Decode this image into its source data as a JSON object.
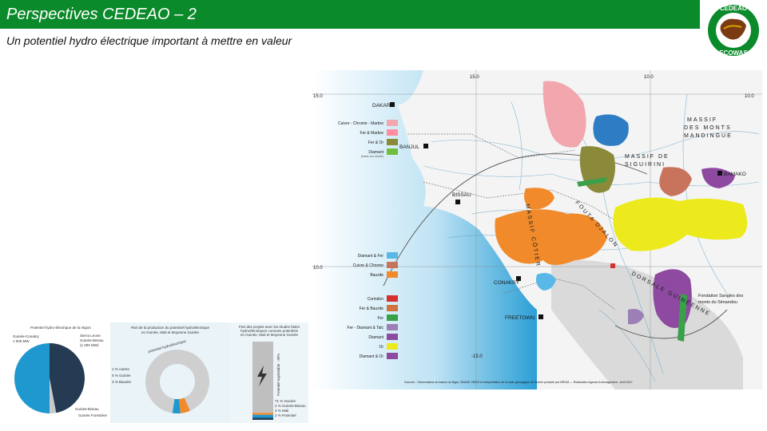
{
  "slide": {
    "title": "Perspectives CEDEAO – 2",
    "subtitle": "Un potentiel hydro électrique important à mettre en valeur"
  },
  "logo": {
    "top_text": "CEDEAO",
    "bottom_text": "ECOWAS",
    "colors": {
      "ring": "#0a8a2a",
      "inner": "#ffffff",
      "map": "#7a3b12",
      "accent": "#d9a300"
    }
  },
  "map": {
    "cities": {
      "dakar": "DAKAR",
      "banjul": "BANJUL",
      "bissau": "BISSAU",
      "conakry": "CONAKRY",
      "freetown": "FREETOWN",
      "bamako": "BAMAKO"
    },
    "regions": {
      "massif_mandingue": [
        "MASSIF",
        "DES MONTS",
        "MANDINGUE"
      ],
      "massif_siguiri": [
        "MASSIF DE",
        "SIGUIRINI"
      ],
      "fouta_djalon": "FOUTA DJALON",
      "massif_cotier": "MASSIF CÔTIER",
      "dorsale_guineenne": "DORSALE GUINÉENNE",
      "fond_guinee": [
        "Fondation Sangles des",
        "monts du Simandou"
      ]
    },
    "grid_labels": {
      "top_left": "15.0",
      "top_mid": "10.0",
      "top_right": "10.0",
      "left_top": "15.0",
      "left_mid": "10.0",
      "bottom": "-15.0"
    },
    "legend_group_1": [
      {
        "label": "Cuivre - Chrome - Marbre",
        "color": "#f2a6ae"
      },
      {
        "label": "Fer & Marbre",
        "color": "#ff8ea0"
      },
      {
        "label": "Fer & Or",
        "color": "#8a8a3a"
      },
      {
        "label": "Diamant",
        "note": "(basin non étudié)",
        "color": "#6fbf3f"
      }
    ],
    "legend_group_2": [
      {
        "label": "Diamant & Fer",
        "color": "#5ab8e8"
      },
      {
        "label": "Cuivre & Chrome",
        "color": "#c8735c"
      },
      {
        "label": "Bauxite",
        "color": "#f08a2a"
      }
    ],
    "legend_group_3": [
      {
        "label": "Corindon",
        "color": "#d4312f"
      },
      {
        "label": "Fer & Bauxite",
        "color": "#d0733c"
      },
      {
        "label": "Fer",
        "color": "#3aa04a"
      },
      {
        "label": "Fer - Diamant & Talc",
        "color": "#9b7fb5"
      },
      {
        "label": "Diamant",
        "color": "#8d4aa0"
      },
      {
        "label": "Or",
        "color": "#ecea1c"
      },
      {
        "label": "Diamant & Or",
        "color": "#8d4aa0"
      }
    ],
    "source": "Sources : Observations au bassin du Niger, SDAGE OMVS et interpretation de la carte géologique de Guinée produite par BRGM — Réalisation Agence Aménagement - Avril 2017"
  },
  "inset1": {
    "title": "Potentiel hydro-électrique de la région",
    "label_left": [
      "Guinée-Conakry",
      "1 000 MW"
    ],
    "label_right": [
      "Sierra Leone",
      "Guinée-Bissau",
      "(1 000 MW)"
    ],
    "label_bottom_1": "Guinée-Bissau",
    "label_bottom_2": "Guinée Forestière",
    "pie": [
      {
        "name": "a",
        "value": 50,
        "color": "#1f98d0"
      },
      {
        "name": "b",
        "value": 47,
        "color": "#243b53"
      },
      {
        "name": "c",
        "value": 3,
        "color": "#c9c9c9"
      }
    ]
  },
  "inset2": {
    "title": [
      "Part de la production du potentiel hydroélectrique",
      "en Guinée, Mali et Moyenne Guinée"
    ],
    "ring_label": "potentiel hydroélectrique",
    "legend": [
      "1 % Autres",
      "5 % Guinée",
      "3 % Bauxite"
    ],
    "ring": [
      {
        "value": 91,
        "color": "#cfcfcf"
      },
      {
        "value": 5,
        "color": "#f08a2a"
      },
      {
        "value": 4,
        "color": "#1f98d0"
      }
    ]
  },
  "inset3": {
    "title": [
      "Part des projets avec les études faites",
      "hydroélectriques connues potentiels",
      "en Guinée, Mali et Moyenne Guinée"
    ],
    "bar_label": "Potentiel exploitable - 30%",
    "legend": [
      "71 % Guinée",
      "2 % Guinée-Bissau",
      "3 % Mali",
      "2 % Potentiel"
    ],
    "segments": [
      {
        "value": 71,
        "color": "#bfbfbf"
      },
      {
        "value": 2,
        "color": "#f08a2a"
      },
      {
        "value": 3,
        "color": "#1f98d0"
      },
      {
        "value": 2,
        "color": "#243b53"
      }
    ]
  }
}
